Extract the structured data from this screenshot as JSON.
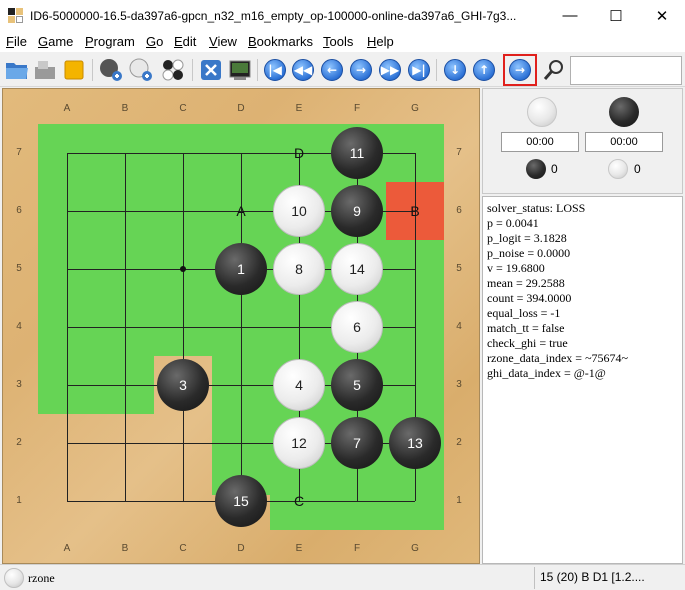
{
  "window": {
    "title": "ID6-5000000-16.5-da397a6-gpcn_n32_m16_empty_op-100000-online-da397a6_GHI-7g3...",
    "minimize_icon": "minimize-icon",
    "maximize_icon": "maximize-icon",
    "close_icon": "close-icon"
  },
  "menu": [
    {
      "label": "File",
      "accel": "F"
    },
    {
      "label": "Game",
      "accel": "G"
    },
    {
      "label": "Program",
      "accel": "P"
    },
    {
      "label": "Go",
      "accel": "G"
    },
    {
      "label": "Edit",
      "accel": "E"
    },
    {
      "label": "View",
      "accel": "V"
    },
    {
      "label": "Bookmarks",
      "accel": "B"
    },
    {
      "label": "Tools",
      "accel": "T"
    },
    {
      "label": "Help",
      "accel": "H"
    }
  ],
  "toolbar": {
    "buttons": [
      "open-folder-icon",
      "save-icon",
      "new-game-icon",
      "play-black-icon",
      "play-white-icon",
      "setup-stones-icon",
      "interrupt-icon",
      "gtp-shell-icon",
      "beginning-icon",
      "back-ten-icon",
      "back-icon",
      "forward-icon",
      "forward-ten-icon",
      "end-icon",
      "down-variation-icon",
      "up-variation-icon",
      "next-variation-icon",
      "find-icon"
    ],
    "search_value": ""
  },
  "board": {
    "columns": [
      "A",
      "B",
      "C",
      "D",
      "E",
      "F",
      "G"
    ],
    "rows": [
      "7",
      "6",
      "5",
      "4",
      "3",
      "2",
      "1"
    ],
    "stones": [
      {
        "point": "F7",
        "color": "black",
        "number": "11"
      },
      {
        "point": "E6",
        "color": "white",
        "number": "10"
      },
      {
        "point": "F6",
        "color": "black",
        "number": "9"
      },
      {
        "point": "D5",
        "color": "black",
        "number": "1"
      },
      {
        "point": "E5",
        "color": "white",
        "number": "8"
      },
      {
        "point": "F5",
        "color": "white",
        "number": "14"
      },
      {
        "point": "F4",
        "color": "white",
        "number": "6"
      },
      {
        "point": "C3",
        "color": "black",
        "number": "3"
      },
      {
        "point": "E3",
        "color": "white",
        "number": "4"
      },
      {
        "point": "F3",
        "color": "black",
        "number": "5"
      },
      {
        "point": "E2",
        "color": "white",
        "number": "12"
      },
      {
        "point": "F2",
        "color": "black",
        "number": "7"
      },
      {
        "point": "G2",
        "color": "black",
        "number": "13"
      },
      {
        "point": "D1",
        "color": "black",
        "number": "15"
      }
    ],
    "labels": [
      {
        "point": "E7",
        "text": "D"
      },
      {
        "point": "D6",
        "text": "A"
      },
      {
        "point": "G6",
        "text": "B"
      },
      {
        "point": "E1",
        "text": "C"
      }
    ],
    "highlight_color": "#66d455",
    "marked_point": {
      "point": "G6",
      "color": "#ec5a3a"
    }
  },
  "players": {
    "white_time": "00:00",
    "black_time": "00:00",
    "black_captures": "0",
    "white_captures": "0"
  },
  "info_lines": [
    "solver_status: LOSS",
    "p = 0.0041",
    "p_logit = 3.1828",
    "p_noise = 0.0000",
    "v = 19.6800",
    "mean = 29.2588",
    "count = 394.0000",
    "equal_loss = -1",
    "match_tt = false",
    "check_ghi = true",
    "rzone_data_index = ~75674~",
    "ghi_data_index = @-1@"
  ],
  "status": {
    "left": "rzone",
    "right": "15 (20) B D1 [1.2...."
  },
  "colors": {
    "active_button_border": "#e0201c"
  }
}
